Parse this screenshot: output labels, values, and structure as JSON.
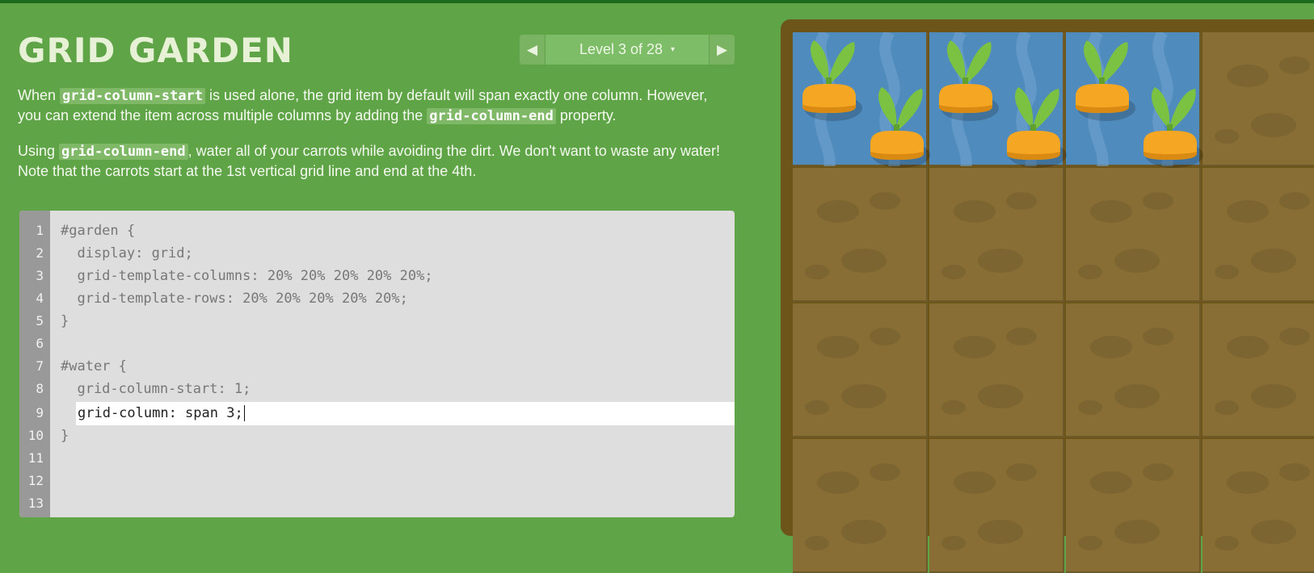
{
  "app": {
    "title": "GRID GARDEN"
  },
  "level_nav": {
    "prev_icon": "triangle-left",
    "label": "Level 3 of 28",
    "caret": "▾",
    "next_icon": "triangle-right"
  },
  "instructions": {
    "p1": {
      "t1": "When ",
      "c1": "grid-column-start",
      "t2": " is used alone, the grid item by default will span exactly one column. However, you can extend the item across multiple columns by adding the ",
      "c2": "grid-column-end",
      "t3": " property."
    },
    "p2": {
      "t1": "Using ",
      "c1": "grid-column-end",
      "t2": ", water all of your carrots while avoiding the dirt. We don't want to waste any water! Note that the carrots start at the 1st vertical grid line and end at the 4th."
    }
  },
  "editor": {
    "line_numbers": [
      "1",
      "2",
      "3",
      "4",
      "5",
      "6",
      "7",
      "8",
      "9",
      "10",
      "11",
      "12",
      "13"
    ],
    "lines": [
      "#garden {",
      "  display: grid;",
      "  grid-template-columns: 20% 20% 20% 20% 20%;",
      "  grid-template-rows: 20% 20% 20% 20% 20%;",
      "}",
      "",
      "#water {",
      "  grid-column-start: 1;",
      "",
      "}"
    ],
    "input_value": "grid-column: span 3;"
  },
  "garden": {
    "columns": 4,
    "rows": 4,
    "watered_columns": 3,
    "carrot_columns": 3,
    "water_color": "#4f8bbd",
    "dirt_color": "#886e34",
    "carrot_color": "#f5a623",
    "leaf_color": "#7cc242"
  },
  "colors": {
    "background": "#5fa447",
    "board_border": "#6d5519"
  }
}
